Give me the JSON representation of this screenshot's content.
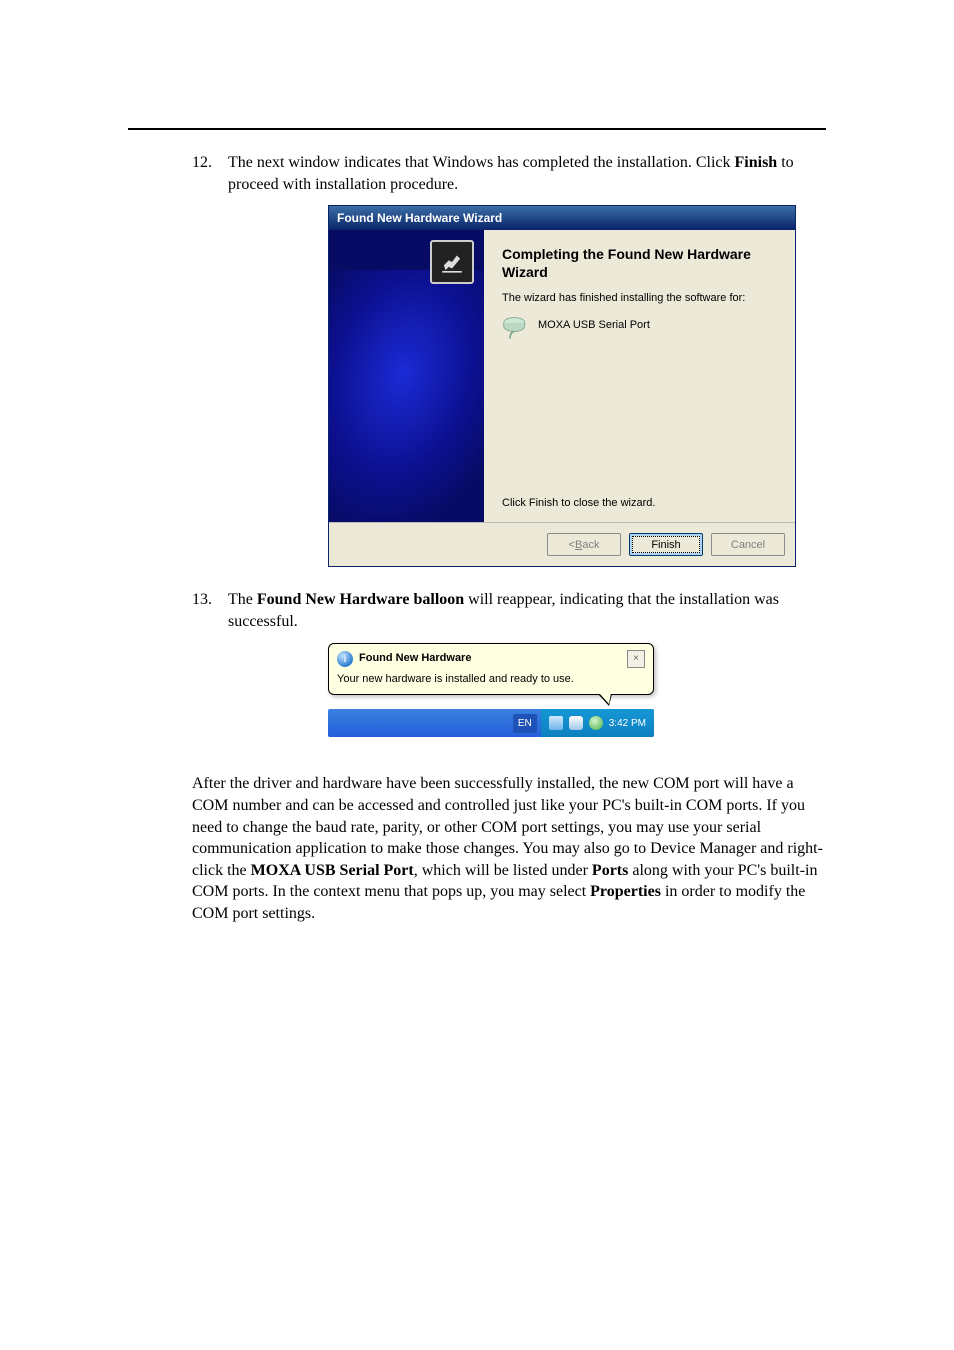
{
  "steps": {
    "item12": {
      "num": "12.",
      "t1": "The next window indicates that Windows has completed the installation. Click ",
      "b1": "Finish",
      "t2": " to proceed with installation procedure."
    },
    "item13": {
      "num": "13.",
      "t1": "The ",
      "b1": "Found New Hardware balloon",
      "t2": " will reappear, indicating that the installation was successful."
    }
  },
  "wizard": {
    "title": "Found New Hardware Wizard",
    "heading": "Completing the Found New Hardware Wizard",
    "line": "The wizard has finished installing the software for:",
    "device": "MOXA USB Serial Port",
    "close_note": "Click Finish to close the wizard.",
    "buttons": {
      "back": "< Back",
      "finish": "Finish",
      "cancel": "Cancel"
    }
  },
  "balloon": {
    "title": "Found New Hardware",
    "msg": "Your new hardware is installed and ready to use.",
    "close": "×"
  },
  "taskbar": {
    "lang": "EN",
    "time": "3:42 PM"
  },
  "paragraph": {
    "p1": "After the driver and hardware have been successfully installed, the new COM port will have a COM number and can be accessed and controlled just like your PC's built-in COM ports. If you need to change the baud rate, parity, or other COM port settings, you may use your serial communication application to make those changes. You may also go to Device Manager and right-click the ",
    "b1": "MOXA USB Serial Port",
    "p2": ", which will be listed under ",
    "b2": "Ports",
    "p3": " along with your PC's built-in COM ports. In the context menu that pops up, you may select ",
    "b3": "Properties",
    "p4": " in order to modify the COM port settings."
  }
}
